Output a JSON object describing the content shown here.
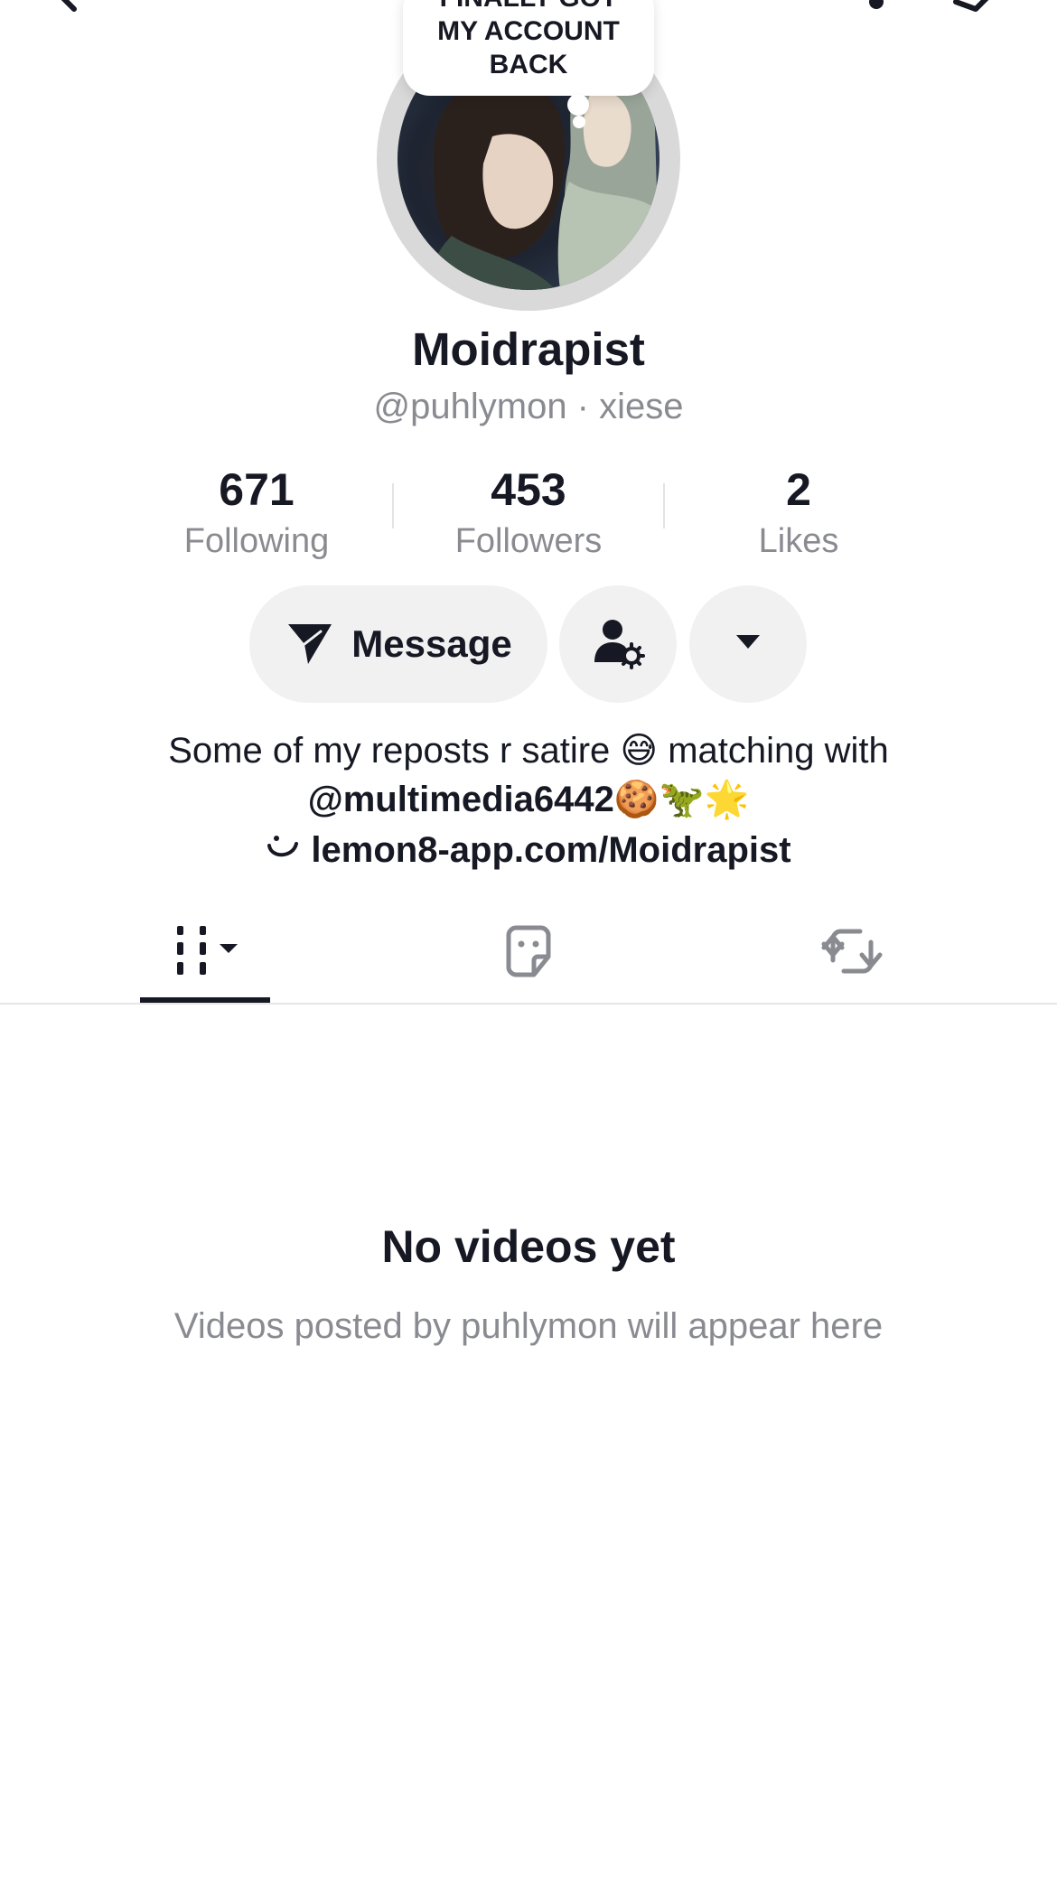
{
  "profile": {
    "note": "FINALLY GOT\nMY ACCOUNT\nBACK",
    "display_name": "Moidrapist",
    "handle_line": "@puhlymon · xiese"
  },
  "stats": [
    {
      "value": "671",
      "label": "Following"
    },
    {
      "value": "453",
      "label": "Followers"
    },
    {
      "value": "2",
      "label": "Likes"
    }
  ],
  "actions": {
    "message_label": "Message"
  },
  "bio": {
    "line1": "Some of my reposts r satire 😅 matching with",
    "mention": "@multimedia6442",
    "emojis": "🍪🦖🌟",
    "link": "lemon8-app.com/Moidrapist"
  },
  "tabs": [
    {
      "name": "videos",
      "icon": "grid-icon",
      "active": true
    },
    {
      "name": "favorites",
      "icon": "sticker-icon",
      "active": false
    },
    {
      "name": "reposts",
      "icon": "repost-icon",
      "active": false
    }
  ],
  "empty_state": {
    "title": "No videos yet",
    "subtitle": "Videos posted by puhlymon will appear here"
  },
  "colors": {
    "text": "#161823",
    "muted": "#8a8b91",
    "button_bg": "#f1f1f2"
  }
}
